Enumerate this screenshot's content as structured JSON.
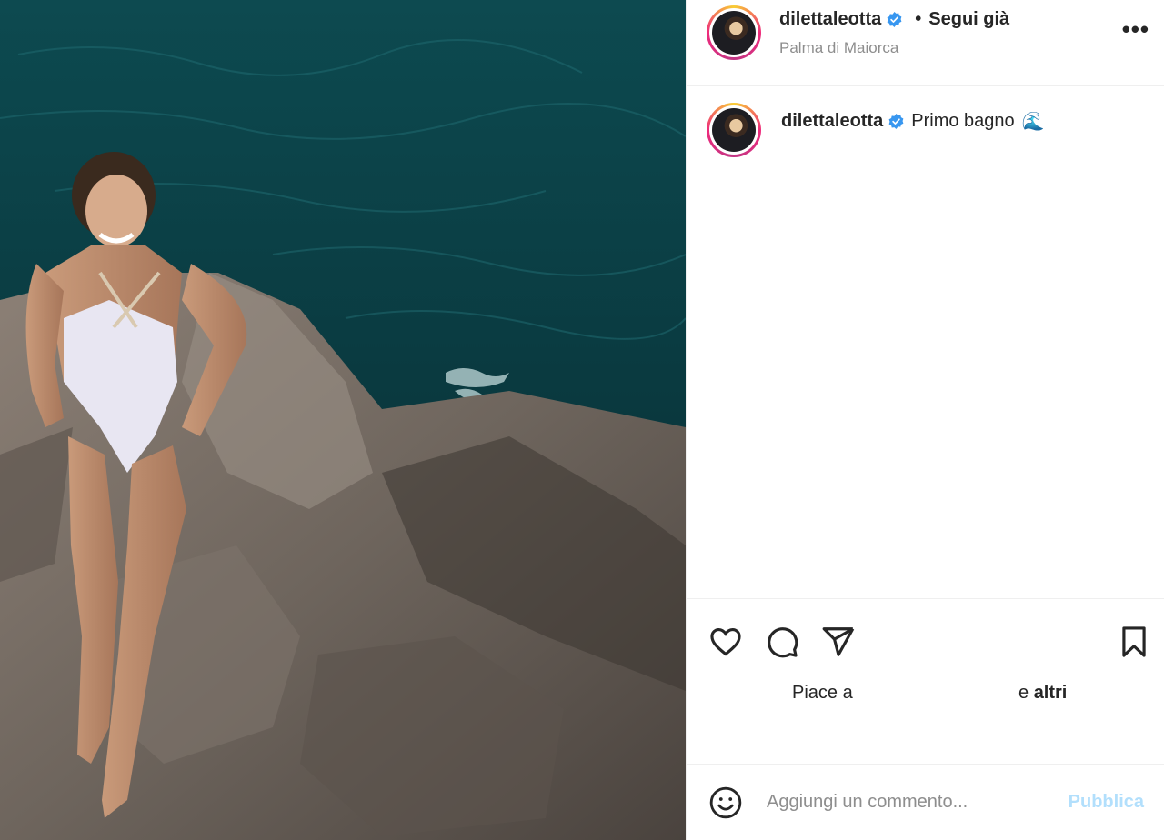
{
  "header": {
    "username": "dilettaleotta",
    "verified_icon": "verified-badge-icon",
    "separator": "•",
    "follow_state": "Segui già",
    "location": "Palma di Maiorca",
    "more_icon": "more-options-icon"
  },
  "caption": {
    "username": "dilettaleotta",
    "text": "Primo bagno",
    "emoji": "🌊"
  },
  "actions": {
    "icons": [
      "heart-icon",
      "comment-icon",
      "share-icon",
      "bookmark-icon"
    ]
  },
  "likes": {
    "prefix": "Piace a",
    "middle": "e",
    "suffix": "altri"
  },
  "comment_box": {
    "placeholder": "Aggiungi un commento...",
    "publish_label": "Pubblica"
  },
  "colors": {
    "verified": "#3897f0",
    "publish_disabled": "#b2dffc",
    "muted_text": "#8e8e8e"
  }
}
